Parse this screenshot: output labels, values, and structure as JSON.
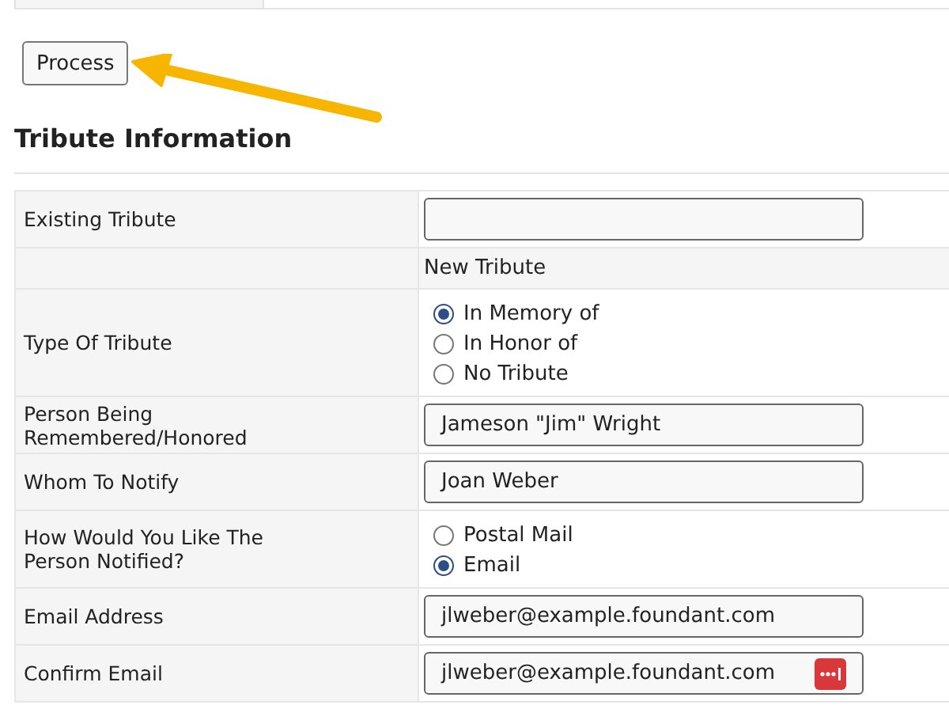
{
  "process_button": {
    "label": "Process"
  },
  "section": {
    "title": "Tribute Information"
  },
  "rows": [
    {
      "kind": "text",
      "label": "Existing Tribute",
      "value": ""
    },
    {
      "kind": "heading",
      "label": "",
      "value": "New Tribute"
    },
    {
      "kind": "radio",
      "label": "Type Of Tribute",
      "options": [
        {
          "label": "In Memory of",
          "selected": true
        },
        {
          "label": "In Honor of",
          "selected": false
        },
        {
          "label": "No Tribute",
          "selected": false
        }
      ]
    },
    {
      "kind": "text",
      "label": "Person Being Remembered/Honored",
      "value": "Jameson \"Jim\" Wright"
    },
    {
      "kind": "text",
      "label": "Whom To Notify",
      "value": "Joan Weber"
    },
    {
      "kind": "radio",
      "label": "How Would You Like The Person Notified?",
      "options": [
        {
          "label": "Postal Mail",
          "selected": false
        },
        {
          "label": "Email",
          "selected": true
        }
      ]
    },
    {
      "kind": "text",
      "label": "Email Address",
      "value": "jlweber@example.foundant.com"
    },
    {
      "kind": "text",
      "label": "Confirm Email",
      "value": "jlweber@example.foundant.com",
      "password_manager": true
    }
  ]
}
